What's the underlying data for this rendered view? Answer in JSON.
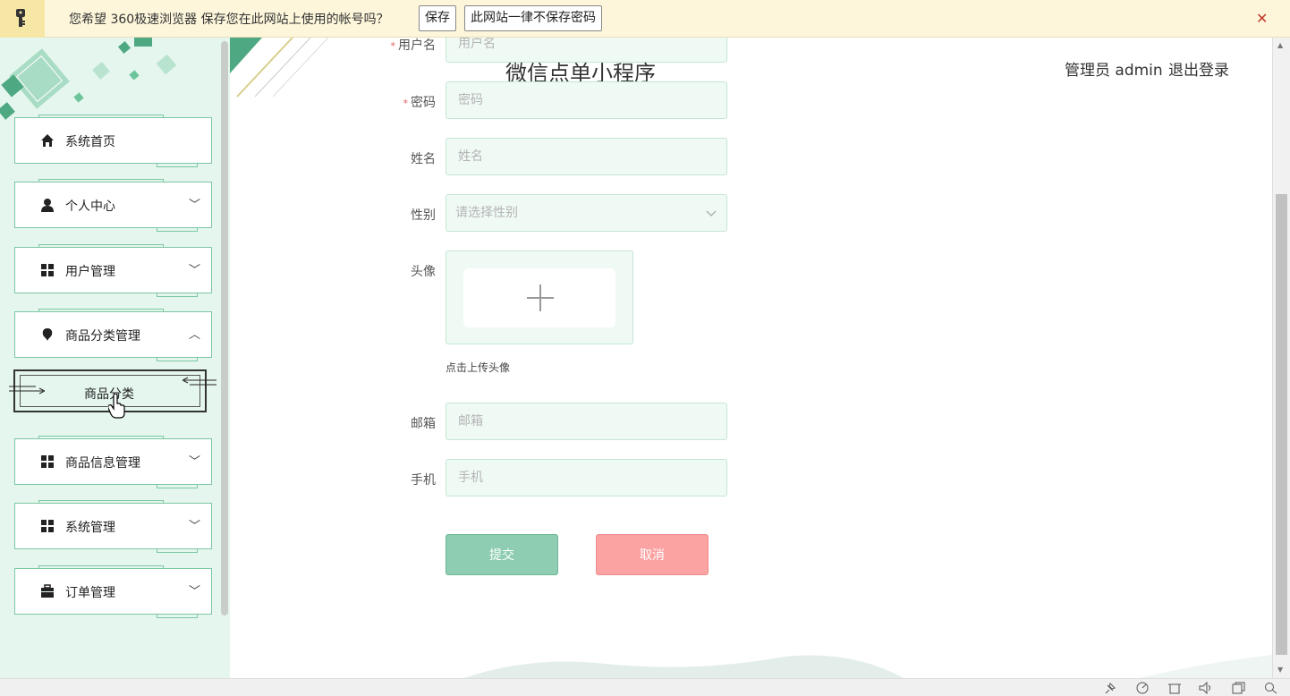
{
  "password_bar": {
    "message": "您希望 360极速浏览器 保存您在此网站上使用的帐号吗？",
    "save_label": "保存",
    "never_label": "此网站一律不保存密码",
    "close_glyph": "✕"
  },
  "sidebar": {
    "items": [
      {
        "label": "系统首页",
        "icon": "home-icon"
      },
      {
        "label": "个人中心",
        "icon": "person-icon",
        "arrow": "﹀"
      },
      {
        "label": "用户管理",
        "icon": "grid-icon",
        "arrow": "﹀"
      },
      {
        "label": "商品分类管理",
        "icon": "bulb-icon",
        "arrow": "︿"
      },
      {
        "label": "商品信息管理",
        "icon": "grid-icon",
        "arrow": "﹀"
      },
      {
        "label": "系统管理",
        "icon": "grid-icon",
        "arrow": "﹀"
      },
      {
        "label": "订单管理",
        "icon": "briefcase-icon",
        "arrow": "﹀"
      }
    ],
    "sub_item": {
      "label": "商品分类"
    }
  },
  "header": {
    "title": "微信点单小程序",
    "user": "管理员 admin",
    "logout": "退出登录"
  },
  "form": {
    "username": {
      "label": "用户名",
      "placeholder": "用户名",
      "required": "*"
    },
    "password": {
      "label": "密码",
      "placeholder": "密码",
      "required": "*"
    },
    "name": {
      "label": "姓名",
      "placeholder": "姓名"
    },
    "gender": {
      "label": "性别",
      "placeholder": "请选择性别"
    },
    "avatar": {
      "label": "头像",
      "tip": "点击上传头像",
      "plus": "+"
    },
    "email": {
      "label": "邮箱",
      "placeholder": "邮箱"
    },
    "phone": {
      "label": "手机",
      "placeholder": "手机"
    },
    "submit_label": "提交",
    "cancel_label": "取消"
  },
  "colors": {
    "accent": "#8ecdb1",
    "cancel": "#fba3a3",
    "sidebar_bg": "#e5f6ee",
    "notice_bg": "#fdf6db"
  }
}
